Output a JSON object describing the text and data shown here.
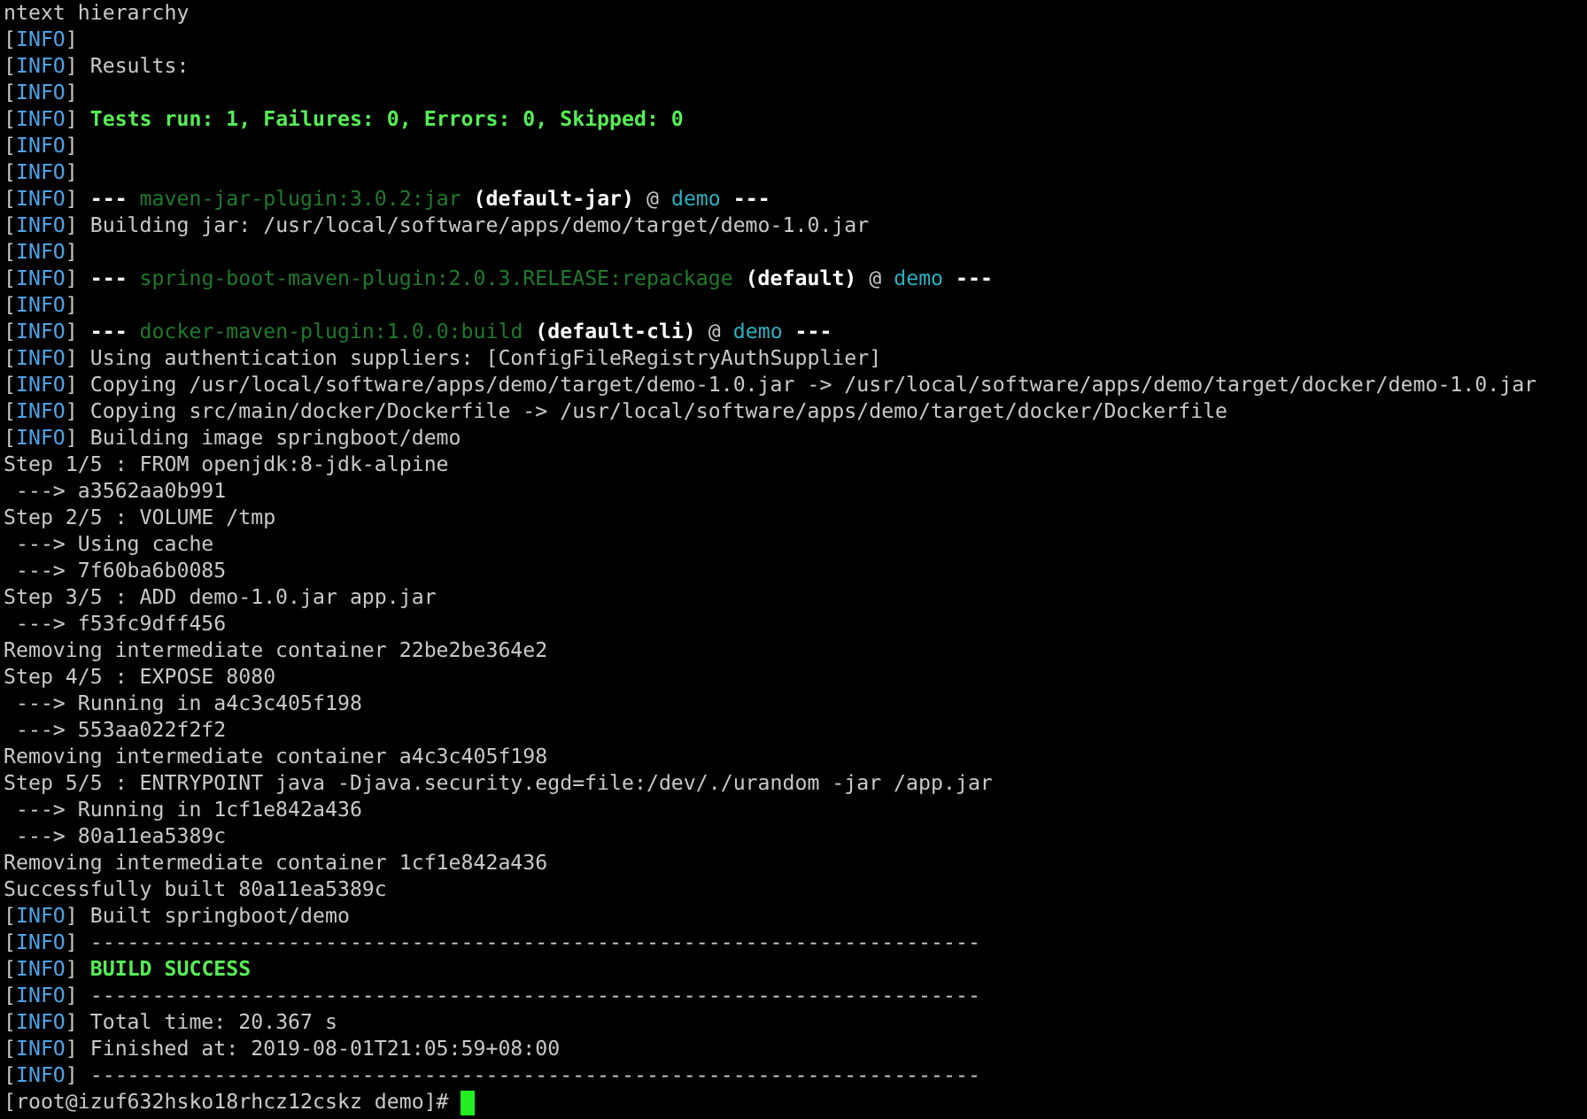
{
  "terminal": {
    "lines": [
      [
        {
          "kind": "plain",
          "t": "ntext hierarchy"
        }
      ],
      [
        {
          "kind": "plain",
          "t": "["
        },
        {
          "kind": "info",
          "t": "INFO"
        },
        {
          "kind": "plain",
          "t": "]"
        }
      ],
      [
        {
          "kind": "plain",
          "t": "["
        },
        {
          "kind": "info",
          "t": "INFO"
        },
        {
          "kind": "plain",
          "t": "] Results:"
        }
      ],
      [
        {
          "kind": "plain",
          "t": "["
        },
        {
          "kind": "info",
          "t": "INFO"
        },
        {
          "kind": "plain",
          "t": "]"
        }
      ],
      [
        {
          "kind": "plain",
          "t": "["
        },
        {
          "kind": "info",
          "t": "INFO"
        },
        {
          "kind": "plain",
          "t": "] "
        },
        {
          "kind": "success",
          "t": "Tests run: 1, Failures: 0, Errors: 0, Skipped: 0"
        }
      ],
      [
        {
          "kind": "plain",
          "t": "["
        },
        {
          "kind": "info",
          "t": "INFO"
        },
        {
          "kind": "plain",
          "t": "]"
        }
      ],
      [
        {
          "kind": "plain",
          "t": "["
        },
        {
          "kind": "info",
          "t": "INFO"
        },
        {
          "kind": "plain",
          "t": "]"
        }
      ],
      [
        {
          "kind": "plain",
          "t": "["
        },
        {
          "kind": "info",
          "t": "INFO"
        },
        {
          "kind": "plain",
          "t": "] "
        },
        {
          "kind": "bold",
          "t": "--- "
        },
        {
          "kind": "plugin",
          "t": "maven-jar-plugin:3.0.2:jar "
        },
        {
          "kind": "bold",
          "t": "(default-jar)"
        },
        {
          "kind": "plain",
          "t": " @ "
        },
        {
          "kind": "project",
          "t": "demo"
        },
        {
          "kind": "bold",
          "t": " ---"
        }
      ],
      [
        {
          "kind": "plain",
          "t": "["
        },
        {
          "kind": "info",
          "t": "INFO"
        },
        {
          "kind": "plain",
          "t": "] Building jar: /usr/local/software/apps/demo/target/demo-1.0.jar"
        }
      ],
      [
        {
          "kind": "plain",
          "t": "["
        },
        {
          "kind": "info",
          "t": "INFO"
        },
        {
          "kind": "plain",
          "t": "]"
        }
      ],
      [
        {
          "kind": "plain",
          "t": "["
        },
        {
          "kind": "info",
          "t": "INFO"
        },
        {
          "kind": "plain",
          "t": "] "
        },
        {
          "kind": "bold",
          "t": "--- "
        },
        {
          "kind": "plugin",
          "t": "spring-boot-maven-plugin:2.0.3.RELEASE:repackage "
        },
        {
          "kind": "bold",
          "t": "(default)"
        },
        {
          "kind": "plain",
          "t": " @ "
        },
        {
          "kind": "project",
          "t": "demo"
        },
        {
          "kind": "bold",
          "t": " ---"
        }
      ],
      [
        {
          "kind": "plain",
          "t": "["
        },
        {
          "kind": "info",
          "t": "INFO"
        },
        {
          "kind": "plain",
          "t": "]"
        }
      ],
      [
        {
          "kind": "plain",
          "t": "["
        },
        {
          "kind": "info",
          "t": "INFO"
        },
        {
          "kind": "plain",
          "t": "] "
        },
        {
          "kind": "bold",
          "t": "--- "
        },
        {
          "kind": "plugin",
          "t": "docker-maven-plugin:1.0.0:build "
        },
        {
          "kind": "bold",
          "t": "(default-cli)"
        },
        {
          "kind": "plain",
          "t": " @ "
        },
        {
          "kind": "project",
          "t": "demo"
        },
        {
          "kind": "bold",
          "t": " ---"
        }
      ],
      [
        {
          "kind": "plain",
          "t": "["
        },
        {
          "kind": "info",
          "t": "INFO"
        },
        {
          "kind": "plain",
          "t": "] Using authentication suppliers: [ConfigFileRegistryAuthSupplier]"
        }
      ],
      [
        {
          "kind": "plain",
          "t": "["
        },
        {
          "kind": "info",
          "t": "INFO"
        },
        {
          "kind": "plain",
          "t": "] Copying /usr/local/software/apps/demo/target/demo-1.0.jar -> /usr/local/software/apps/demo/target/docker/demo-1.0.jar"
        }
      ],
      [
        {
          "kind": "plain",
          "t": "["
        },
        {
          "kind": "info",
          "t": "INFO"
        },
        {
          "kind": "plain",
          "t": "] Copying src/main/docker/Dockerfile -> /usr/local/software/apps/demo/target/docker/Dockerfile"
        }
      ],
      [
        {
          "kind": "plain",
          "t": "["
        },
        {
          "kind": "info",
          "t": "INFO"
        },
        {
          "kind": "plain",
          "t": "] Building image springboot/demo"
        }
      ],
      [
        {
          "kind": "plain",
          "t": "Step 1/5 : FROM openjdk:8-jdk-alpine"
        }
      ],
      [
        {
          "kind": "plain",
          "t": " ---> a3562aa0b991"
        }
      ],
      [
        {
          "kind": "plain",
          "t": "Step 2/5 : VOLUME /tmp"
        }
      ],
      [
        {
          "kind": "plain",
          "t": " ---> Using cache"
        }
      ],
      [
        {
          "kind": "plain",
          "t": " ---> 7f60ba6b0085"
        }
      ],
      [
        {
          "kind": "plain",
          "t": "Step 3/5 : ADD demo-1.0.jar app.jar"
        }
      ],
      [
        {
          "kind": "plain",
          "t": " ---> f53fc9dff456"
        }
      ],
      [
        {
          "kind": "plain",
          "t": "Removing intermediate container 22be2be364e2"
        }
      ],
      [
        {
          "kind": "plain",
          "t": "Step 4/5 : EXPOSE 8080"
        }
      ],
      [
        {
          "kind": "plain",
          "t": " ---> Running in a4c3c405f198"
        }
      ],
      [
        {
          "kind": "plain",
          "t": " ---> 553aa022f2f2"
        }
      ],
      [
        {
          "kind": "plain",
          "t": "Removing intermediate container a4c3c405f198"
        }
      ],
      [
        {
          "kind": "plain",
          "t": "Step 5/5 : ENTRYPOINT java -Djava.security.egd=file:/dev/./urandom -jar /app.jar"
        }
      ],
      [
        {
          "kind": "plain",
          "t": " ---> Running in 1cf1e842a436"
        }
      ],
      [
        {
          "kind": "plain",
          "t": " ---> 80a11ea5389c"
        }
      ],
      [
        {
          "kind": "plain",
          "t": "Removing intermediate container 1cf1e842a436"
        }
      ],
      [
        {
          "kind": "plain",
          "t": "Successfully built 80a11ea5389c"
        }
      ],
      [
        {
          "kind": "plain",
          "t": "["
        },
        {
          "kind": "info",
          "t": "INFO"
        },
        {
          "kind": "plain",
          "t": "] Built springboot/demo"
        }
      ],
      [
        {
          "kind": "plain",
          "t": "["
        },
        {
          "kind": "info",
          "t": "INFO"
        },
        {
          "kind": "plain",
          "t": "] ------------------------------------------------------------------------"
        }
      ],
      [
        {
          "kind": "plain",
          "t": "["
        },
        {
          "kind": "info",
          "t": "INFO"
        },
        {
          "kind": "plain",
          "t": "] "
        },
        {
          "kind": "success",
          "t": "BUILD SUCCESS"
        }
      ],
      [
        {
          "kind": "plain",
          "t": "["
        },
        {
          "kind": "info",
          "t": "INFO"
        },
        {
          "kind": "plain",
          "t": "] ------------------------------------------------------------------------"
        }
      ],
      [
        {
          "kind": "plain",
          "t": "["
        },
        {
          "kind": "info",
          "t": "INFO"
        },
        {
          "kind": "plain",
          "t": "] Total time: 20.367 s"
        }
      ],
      [
        {
          "kind": "plain",
          "t": "["
        },
        {
          "kind": "info",
          "t": "INFO"
        },
        {
          "kind": "plain",
          "t": "] Finished at: 2019-08-01T21:05:59+08:00"
        }
      ],
      [
        {
          "kind": "plain",
          "t": "["
        },
        {
          "kind": "info",
          "t": "INFO"
        },
        {
          "kind": "plain",
          "t": "] ------------------------------------------------------------------------"
        }
      ]
    ],
    "prompt": "[root@izuf632hsko18rhcz12cskz demo]# "
  }
}
